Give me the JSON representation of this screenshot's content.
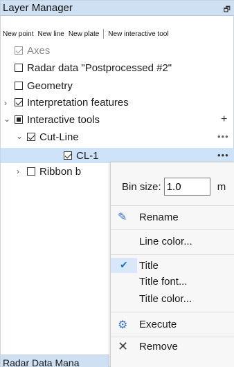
{
  "panel": {
    "title": "Layer Manager",
    "pin_icon": "pin-icon",
    "toolbar": {
      "new_point": "New point",
      "new_line": "New line",
      "new_plate": "New plate",
      "new_interactive_tool": "New interactive tool"
    },
    "tree": {
      "axes": "Axes",
      "radar_data": "Radar data \"Postprocessed #2\"",
      "geometry": "Geometry",
      "interpretation_features": "Interpretation features",
      "interactive_tools": "Interactive tools",
      "cut_line": "Cut-Line",
      "cl1": "CL-1",
      "ribbon": "Ribbon b"
    },
    "plus": "+",
    "dots": "•••",
    "bottom_tab": "Radar Data Mana"
  },
  "context_menu": {
    "bin_size_label": "Bin size:",
    "bin_size_value": "1.0",
    "bin_size_unit": "m",
    "rename": "Rename",
    "line_color": "Line color...",
    "title": "Title",
    "title_font": "Title font...",
    "title_color": "Title color...",
    "execute": "Execute",
    "remove": "Remove"
  },
  "colors": {
    "titlebar": "#cfe0f3",
    "selection": "#cfe3f8",
    "rename_icon": "#3a6fc9",
    "execute_icon": "#3a6fc9",
    "check": "#1f6fcf"
  }
}
